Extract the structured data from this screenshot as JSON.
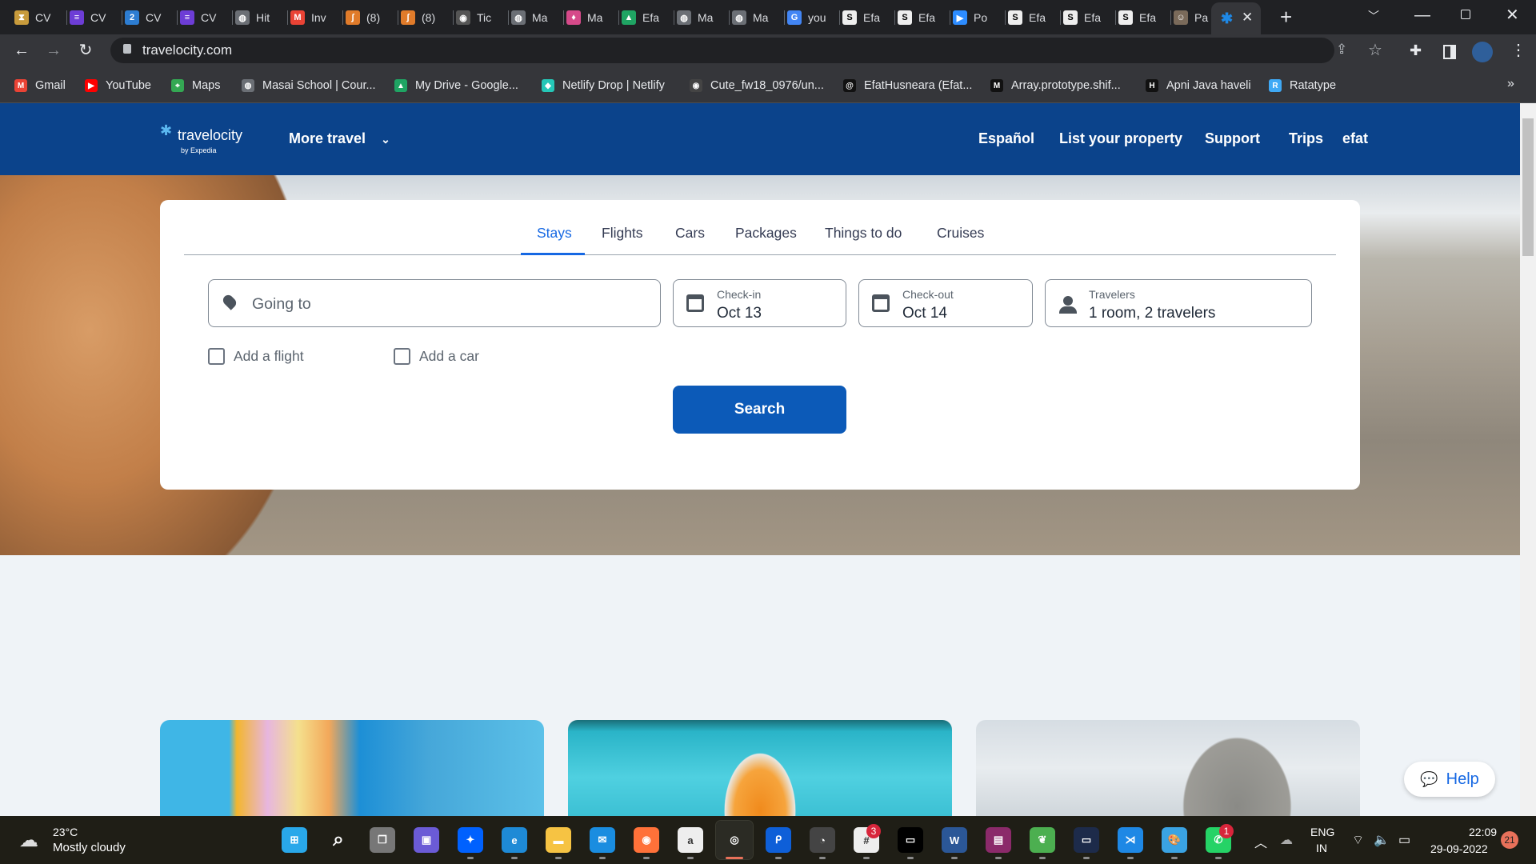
{
  "browser": {
    "tabs": [
      {
        "label": "CV",
        "icon": "hourglass-icon"
      },
      {
        "label": "CV",
        "icon": "list-icon"
      },
      {
        "label": "CV",
        "icon": "number-2-icon"
      },
      {
        "label": "CV",
        "icon": "list-icon"
      },
      {
        "label": "Hit",
        "icon": "globe-icon"
      },
      {
        "label": "Inv",
        "icon": "gmail-icon"
      },
      {
        "label": "(8)",
        "icon": "masai-icon"
      },
      {
        "label": "(8)",
        "icon": "masai-icon"
      },
      {
        "label": "Tic",
        "icon": "github-icon"
      },
      {
        "label": "Ma",
        "icon": "globe-icon"
      },
      {
        "label": "Ma",
        "icon": "balloon-icon"
      },
      {
        "label": "Efa",
        "icon": "drive-icon"
      },
      {
        "label": "Ma",
        "icon": "globe-icon"
      },
      {
        "label": "Ma",
        "icon": "globe-icon"
      },
      {
        "label": "you",
        "icon": "google-icon"
      },
      {
        "label": "Efa",
        "icon": "s-logo-icon"
      },
      {
        "label": "Efa",
        "icon": "s-logo-icon"
      },
      {
        "label": "Po",
        "icon": "zoom-icon"
      },
      {
        "label": "Efa",
        "icon": "s-logo-icon"
      },
      {
        "label": "Efa",
        "icon": "s-logo-icon"
      },
      {
        "label": "Efa",
        "icon": "s-logo-icon"
      },
      {
        "label": "Pa",
        "icon": "profile-photo-icon"
      }
    ],
    "active_tab_icon": "travelocity-icon",
    "url": "travelocity.com",
    "bookmarks": [
      {
        "label": "Gmail",
        "icon": "gmail-icon"
      },
      {
        "label": "YouTube",
        "icon": "youtube-icon"
      },
      {
        "label": "Maps",
        "icon": "maps-icon"
      },
      {
        "label": "Masai School | Cour...",
        "icon": "globe-icon"
      },
      {
        "label": "My Drive - Google...",
        "icon": "drive-icon"
      },
      {
        "label": "Netlify Drop | Netlify",
        "icon": "netlify-icon"
      },
      {
        "label": "Cute_fw18_0976/un...",
        "icon": "github-icon"
      },
      {
        "label": "EfatHusneara (Efat...",
        "icon": "codewars-icon"
      },
      {
        "label": "Array.prototype.shif...",
        "icon": "mdn-icon"
      },
      {
        "label": "Apni Java haveli",
        "icon": "hashnode-icon"
      },
      {
        "label": "Ratatype",
        "icon": "ratatype-icon"
      }
    ],
    "more_bookmarks": "»"
  },
  "site": {
    "logo_text": "travelocity",
    "logo_sub": "by Expedia",
    "more_travel": "More travel",
    "nav": [
      "Español",
      "List your property",
      "Support",
      "Trips",
      "efat"
    ],
    "colors": {
      "header": "#0b438b",
      "accent": "#1668e3",
      "button": "#0c5ab8"
    }
  },
  "search": {
    "tabs": [
      "Stays",
      "Flights",
      "Cars",
      "Packages",
      "Things to do",
      "Cruises"
    ],
    "active_tab": "Stays",
    "destination_placeholder": "Going to",
    "checkin_label": "Check-in",
    "checkin_value": "Oct 13",
    "checkout_label": "Check-out",
    "checkout_value": "Oct 14",
    "travelers_label": "Travelers",
    "travelers_value": "1 room, 2 travelers",
    "add_flight": "Add a flight",
    "add_car": "Add a car",
    "search_button": "Search"
  },
  "help_button": "Help",
  "taskbar": {
    "weather_temp": "23°C",
    "weather_desc": "Mostly cloudy",
    "slack_badge": "3",
    "whatsapp_badge": "1",
    "lang_line1": "ENG",
    "lang_line2": "IN",
    "time": "22:09",
    "date": "29-09-2022",
    "notifications": "21"
  }
}
